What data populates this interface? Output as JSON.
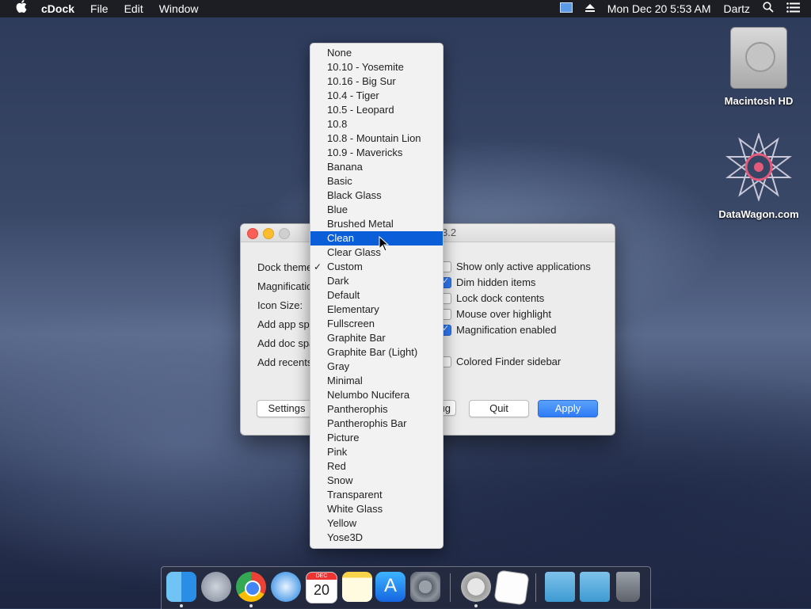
{
  "menubar": {
    "apple": "",
    "app_name": "cDock",
    "menus": [
      "File",
      "Edit",
      "Window"
    ],
    "datetime": "Mon Dec 20  5:53 AM",
    "user": "Dartz"
  },
  "desktop": {
    "icons": [
      {
        "label": "Macintosh HD",
        "icon": "hard-drive-icon"
      },
      {
        "label": "DataWagon.com",
        "icon": "star-logo-icon"
      }
    ]
  },
  "window": {
    "title": "3.2",
    "labels": [
      "Dock theme",
      "Magnificatio",
      "Icon Size:",
      "Add app spa",
      "Add doc spa",
      "Add recents"
    ],
    "checkboxes": [
      {
        "label": "Show only active applications",
        "checked": false
      },
      {
        "label": "Dim hidden items",
        "checked": true
      },
      {
        "label": "Lock dock contents",
        "checked": false
      },
      {
        "label": "Mouse over highlight",
        "checked": false
      },
      {
        "label": "Magnification enabled",
        "checked": true
      },
      {
        "label": "Colored Finder sidebar",
        "checked": false
      }
    ],
    "buttons": {
      "settings": "Settings",
      "debug": "ug",
      "quit": "Quit",
      "apply": "Apply"
    }
  },
  "dropdown": {
    "selected": "Custom",
    "highlighted": "Clean",
    "items": [
      "None",
      "10.10 - Yosemite",
      "10.16 - Big Sur",
      "10.4 - Tiger",
      "10.5 - Leopard",
      "10.8",
      "10.8 - Mountain Lion",
      "10.9 - Mavericks",
      "Banana",
      "Basic",
      "Black Glass",
      "Blue",
      "Brushed Metal",
      "Clean",
      "Clear Glass",
      "Custom",
      "Dark",
      "Default",
      "Elementary",
      "Fullscreen",
      "Graphite Bar",
      "Graphite Bar (Light)",
      "Gray",
      "Minimal",
      "Nelumbo Nucifera",
      "Pantherophis",
      "Pantherophis Bar",
      "Picture",
      "Pink",
      "Red",
      "Snow",
      "Transparent",
      "White Glass",
      "Yellow",
      "Yose3D"
    ]
  },
  "dock": {
    "apps": [
      "finder-icon",
      "launchpad-icon",
      "chrome-icon",
      "safari-icon",
      "calendar-icon",
      "notes-icon",
      "app-store-icon",
      "system-preferences-icon",
      "screenshot-icon",
      "textedit-icon",
      "applications-folder-icon",
      "downloads-folder-icon",
      "trash-icon"
    ],
    "calendar_month": "DEC",
    "calendar_day": "20"
  },
  "colors": {
    "accent": "#0a5fd8",
    "apply_button": "#2f7bf5"
  }
}
